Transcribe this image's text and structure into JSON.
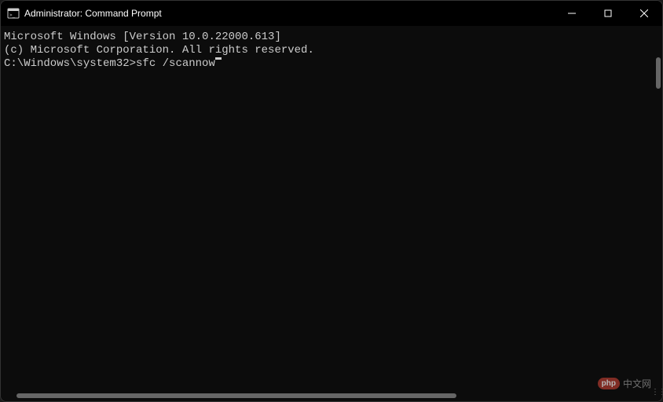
{
  "titlebar": {
    "title": "Administrator: Command Prompt"
  },
  "terminal": {
    "line1": "Microsoft Windows [Version 10.0.22000.613]",
    "line2": "(c) Microsoft Corporation. All rights reserved.",
    "blank": "",
    "prompt": "C:\\Windows\\system32>",
    "command": "sfc /scannow"
  },
  "watermark": {
    "badge": "php",
    "text": "中文网"
  }
}
